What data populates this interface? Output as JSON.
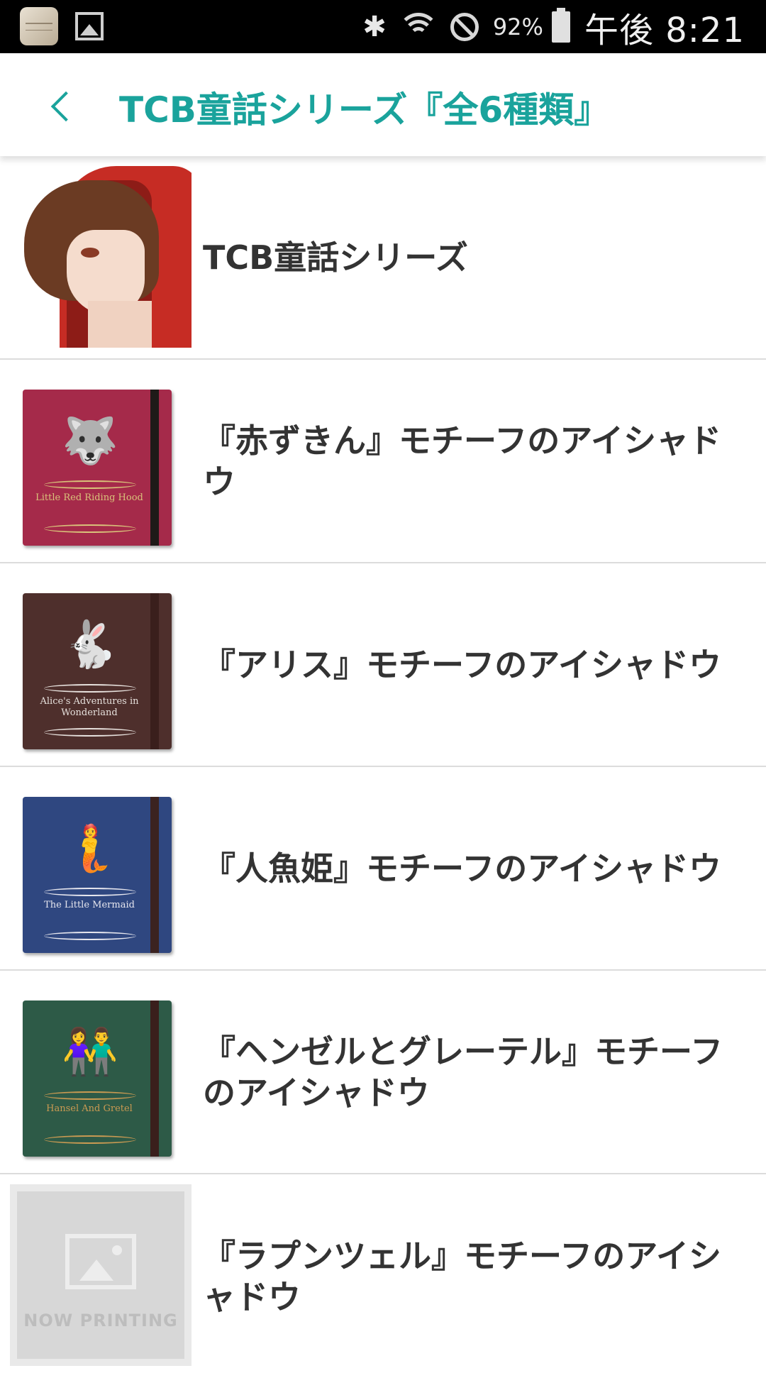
{
  "status_bar": {
    "icons_left": [
      "app-icon",
      "gallery-icon"
    ],
    "bluetooth_glyph": "✱",
    "battery_percent": "92%",
    "time": "午後 8:21"
  },
  "header": {
    "back_icon": "chevron-left-icon",
    "title": "TCB童話シリーズ『全6種類』",
    "accent_color": "#1aa39c"
  },
  "list": {
    "items": [
      {
        "label": "TCB童話シリーズ",
        "thumbnail": "illustration-red-hood-portrait"
      },
      {
        "label": "『赤ずきん』モチーフのアイシャドウ",
        "thumbnail": "book-red",
        "book_color": "#a52a4a",
        "book_text": "Little Red Riding Hood",
        "ink_color": "#d9c27a"
      },
      {
        "label": "『アリス』モチーフのアイシャドウ",
        "thumbnail": "book-brown",
        "book_color": "#4e2f2c",
        "book_text": "Alice's Adventures in Wonderland",
        "ink_color": "#e6e0dc"
      },
      {
        "label": "『人魚姫』モチーフのアイシャドウ",
        "thumbnail": "book-blue",
        "book_color": "#2f4780",
        "book_text": "The Little Mermaid",
        "ink_color": "#e6e6ee"
      },
      {
        "label": "『ヘンゼルとグレーテル』モチーフのアイシャドウ",
        "thumbnail": "book-green",
        "book_color": "#2d5a47",
        "book_text": "Hansel And Gretel",
        "ink_color": "#c99a52"
      },
      {
        "label": "『ラプンツェル』モチーフのアイシャドウ",
        "thumbnail": "placeholder",
        "placeholder_text": "NOW PRINTING"
      }
    ]
  }
}
